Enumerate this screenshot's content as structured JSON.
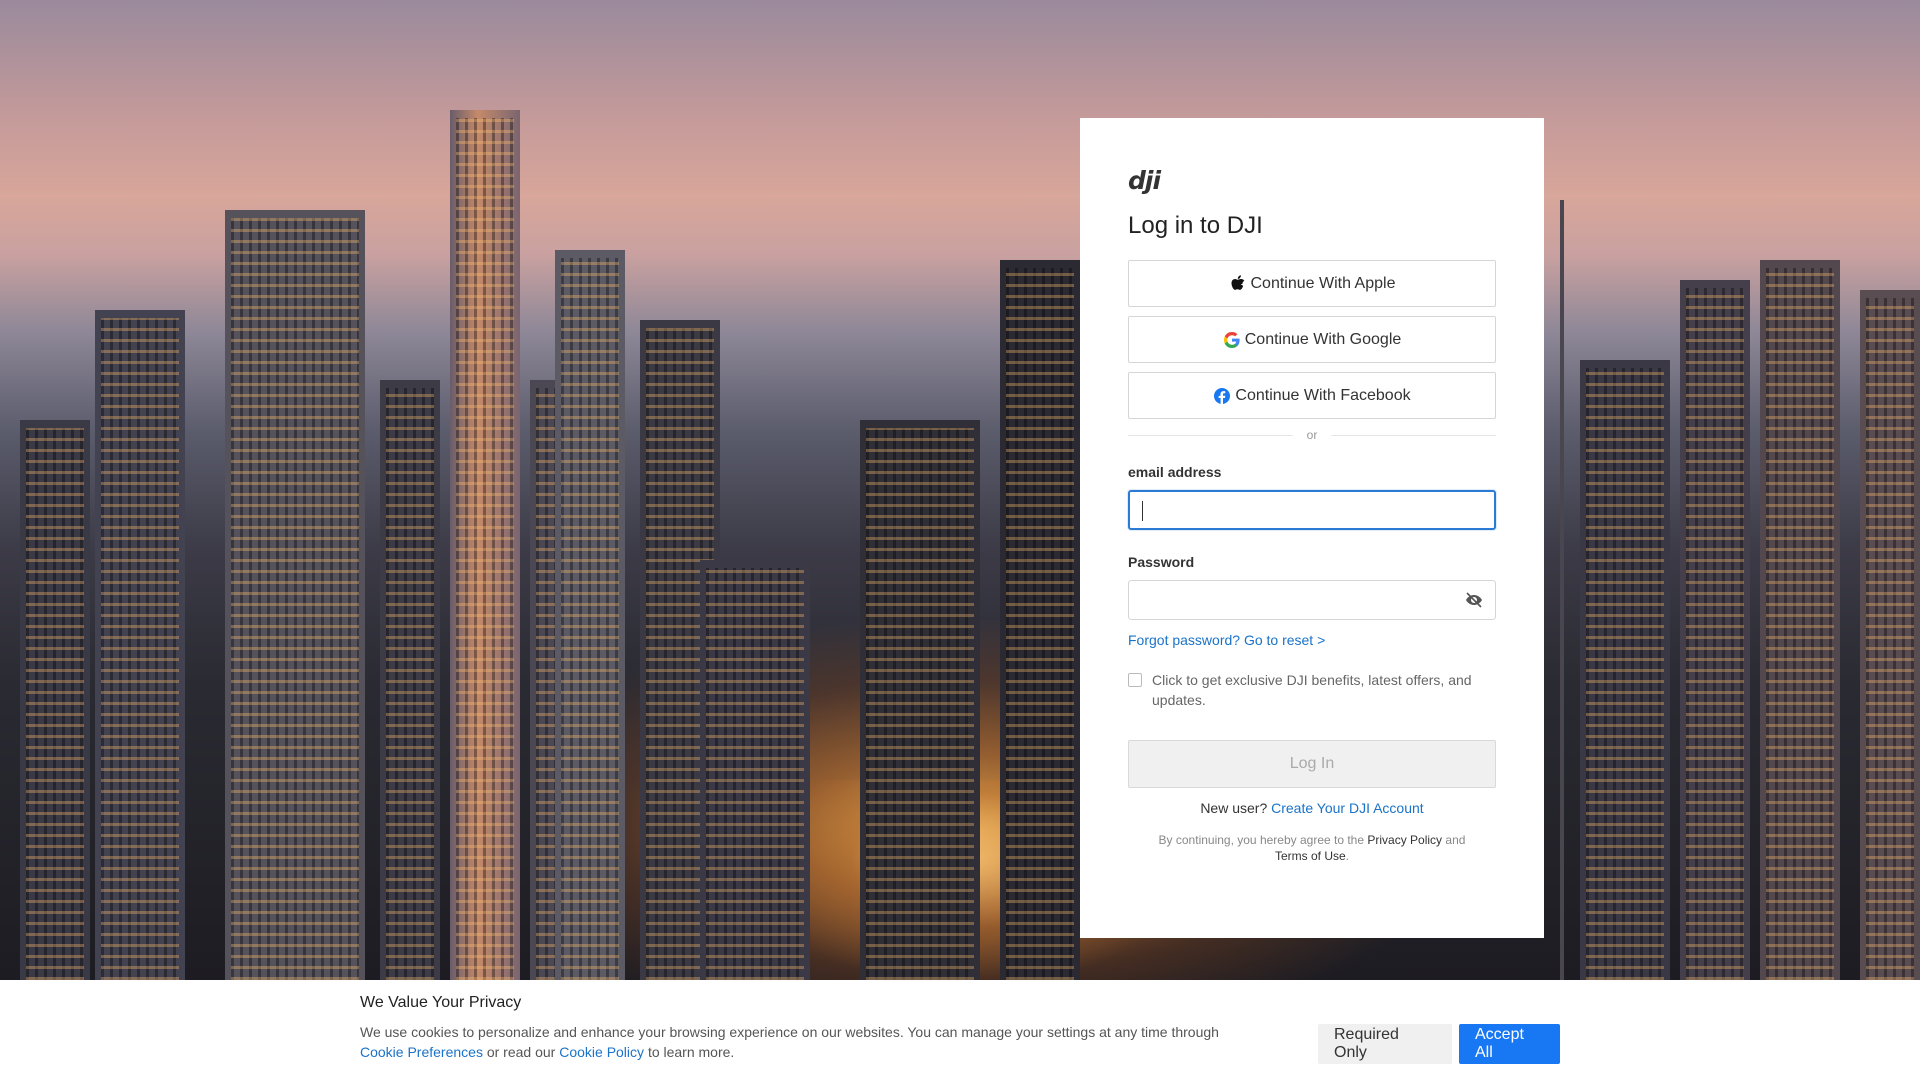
{
  "brand": {
    "logo_text": "dji"
  },
  "login": {
    "title": "Log in to DJI",
    "sso": [
      {
        "label": "Continue With Apple",
        "icon": "apple-icon"
      },
      {
        "label": "Continue With Google",
        "icon": "google-icon"
      },
      {
        "label": "Continue With Facebook",
        "icon": "facebook-icon"
      }
    ],
    "divider": "or",
    "email": {
      "label": "email address",
      "value": "",
      "placeholder": ""
    },
    "password": {
      "label": "Password",
      "value": "",
      "placeholder": "",
      "toggle_icon": "eye-off-icon"
    },
    "forgot": "Forgot password? Go to reset >",
    "consent": {
      "checked": false,
      "text": "Click to get exclusive DJI benefits, latest offers, and updates."
    },
    "submit": "Log In",
    "new_user": {
      "prefix": "New user?",
      "link": "Create Your DJI Account"
    },
    "legal": {
      "prefix": "By continuing, you hereby agree to the",
      "privacy": "Privacy Policy",
      "and": "and",
      "terms": "Terms of Use",
      "suffix": "."
    }
  },
  "cookie": {
    "title": "We Value Your Privacy",
    "text_start": "We use cookies to personalize and enhance your browsing experience on our websites. You can manage your settings at any time through",
    "prefs_link": "Cookie Preferences",
    "middle": "or read our",
    "policy_link": "Cookie Policy",
    "end": "to learn more.",
    "required_btn": "Required Only",
    "accept_btn": "Accept All"
  },
  "colors": {
    "link": "#1a73c8",
    "accept": "#1877f2",
    "focus": "#2b7bd4"
  }
}
